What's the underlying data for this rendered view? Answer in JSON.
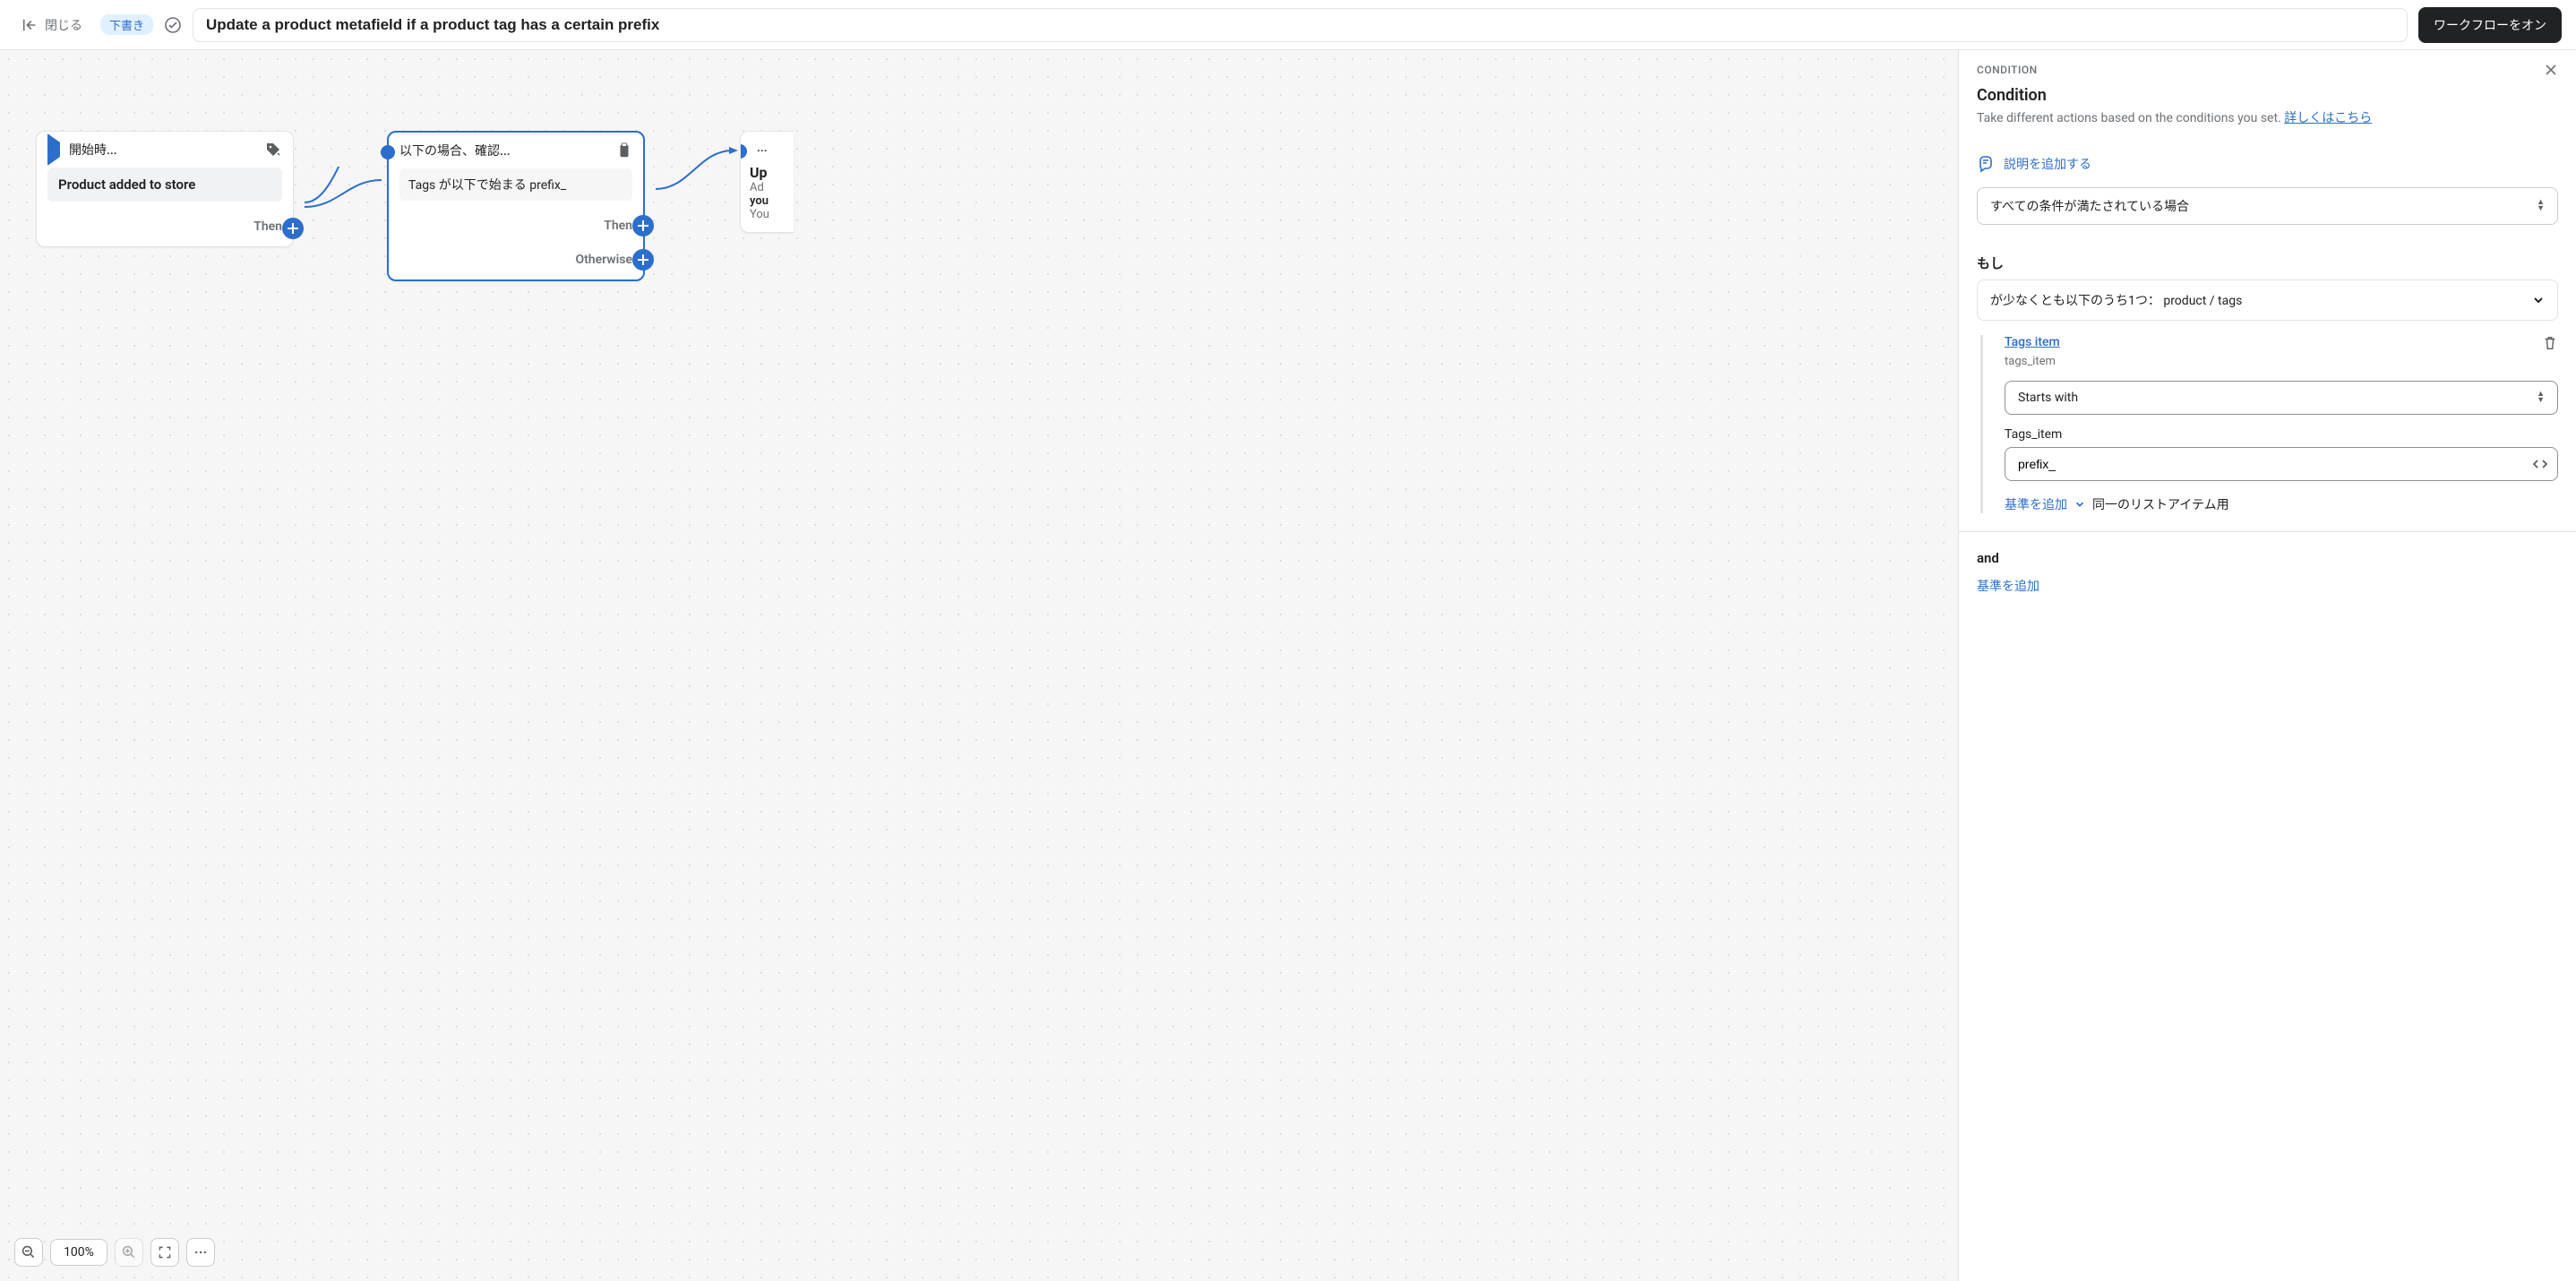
{
  "topbar": {
    "close": "閉じる",
    "draft_badge": "下書き",
    "title": "Update a product metafield if a product tag has a certain prefix",
    "primary_btn": "ワークフローをオン"
  },
  "canvas": {
    "node1": {
      "header": "開始時...",
      "body": "Product added to store",
      "then": "Then"
    },
    "node2": {
      "header": "以下の場合、確認...",
      "body": "Tags が以下で始まる prefix_",
      "then": "Then",
      "otherwise": "Otherwise"
    },
    "node3": {
      "header": "...",
      "title": "Up",
      "l1": "Ad",
      "l2": "you",
      "l3": "You"
    },
    "zoom": "100%"
  },
  "panel": {
    "top_label": "CONDITION",
    "title": "Condition",
    "subtitle": "Take different actions based on the conditions you set. ",
    "learn_more": "詳しくはこちら",
    "add_desc": "説明を追加する",
    "match_select": "すべての条件が満たされている場合",
    "if_label": "もし",
    "collapse_text": "が少なくとも以下のうち1つ：  product / tags",
    "cond": {
      "link": "Tags item",
      "sub": "tags_item",
      "operator": "Starts with",
      "field_label": "Tags_item",
      "value": "prefix_"
    },
    "add_criteria": "基準を追加",
    "same_item": "同一のリストアイテム用",
    "and": "and",
    "add_criteria2": "基準を追加"
  }
}
